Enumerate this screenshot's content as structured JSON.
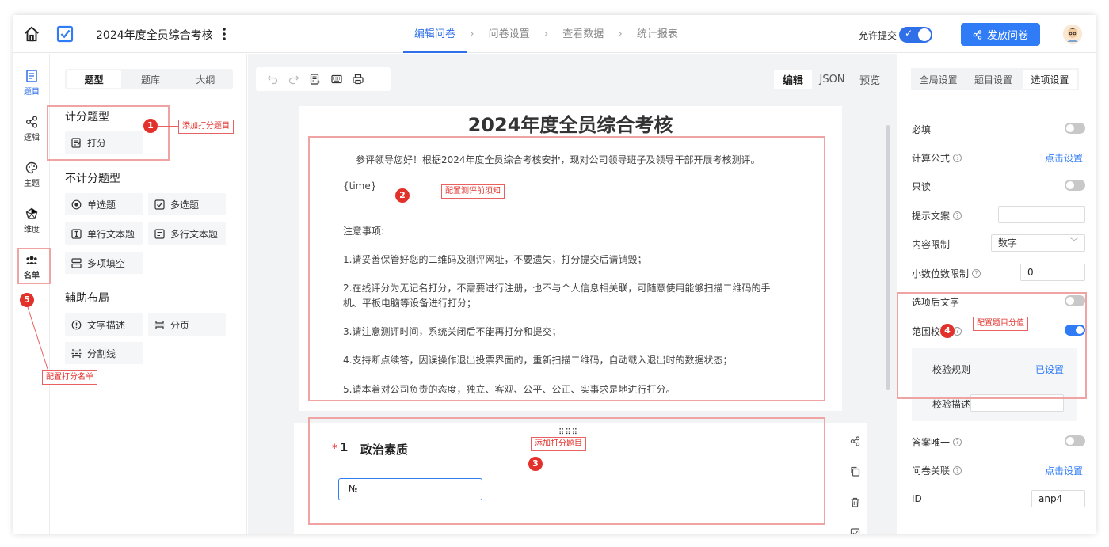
{
  "header": {
    "survey_title": "2024年度全员综合考核",
    "steps": [
      "编辑问卷",
      "问卷设置",
      "查看数据",
      "统计报表"
    ],
    "allow_submit_label": "允许提交",
    "publish_label": "发放问卷"
  },
  "rail": {
    "items": [
      "题目",
      "逻辑",
      "主题",
      "维度",
      "名单"
    ]
  },
  "panel": {
    "tabs": [
      "题型",
      "题库",
      "大纲"
    ],
    "sections": {
      "scoring": "计分题型",
      "non_scoring": "不计分题型",
      "layout": "辅助布局"
    },
    "scoring_widgets": [
      "打分"
    ],
    "non_scoring_widgets": [
      "单选题",
      "多选题",
      "单行文本题",
      "多行文本题",
      "多项填空"
    ],
    "layout_widgets": [
      "文字描述",
      "分页",
      "分割线"
    ]
  },
  "canvas": {
    "view_tabs": [
      "编辑",
      "JSON",
      "预览"
    ],
    "paper_title": "2024年度全员综合考核",
    "notice_lines": [
      "参评领导您好！根据2024年度全员综合考核安排，现对公司领导班子及领导干部开展考核测评。",
      "{time}",
      "注意事项:",
      "1.请妥善保管好您的二维码及测评网址，不要遗失，打分提交后请销毁；",
      "2.在线评分为无记名打分，不需要进行注册，也不与个人信息相关联，可随意使用能够扫描二维码的手",
      "机、平板电脑等设备进行打分；",
      "3.请注意测评时间，系统关闭后不能再打分和提交；",
      "4.支持断点续答，因误操作退出投票界面的，重新扫描二维码，自动载入退出时的数据状态；",
      "5.请本着对公司负责的态度，独立、客观、公平、公正、实事求是地进行打分。"
    ],
    "question": {
      "required_mark": "*",
      "number": "1",
      "title": "政治素质",
      "input_value": "№"
    }
  },
  "rpanel": {
    "tabs": [
      "全局设置",
      "题目设置",
      "选项设置"
    ],
    "rows": {
      "required": "必填",
      "formula": "计算公式",
      "formula_link": "点击设置",
      "readonly": "只读",
      "hint": "提示文案",
      "content_limit": "内容限制",
      "content_limit_value": "数字",
      "decimal_limit": "小数位数限制",
      "decimal_value": "0",
      "after_text": "选项后文字",
      "range_check": "范围校验",
      "check_rule": "校验规则",
      "check_rule_link": "已设置",
      "check_desc": "校验描述",
      "unique": "答案唯一",
      "link_survey": "问卷关联",
      "link_survey_link": "点击设置",
      "id_label": "ID",
      "id_value": "anp4"
    }
  },
  "annotations": {
    "a1": {
      "num": "1",
      "label": "添加打分题目"
    },
    "a2": {
      "num": "2",
      "label": "配置测评前须知"
    },
    "a3": {
      "num": "3",
      "label": "添加打分题目"
    },
    "a4": {
      "num": "4",
      "label": "配置题目分值"
    },
    "a5": {
      "num": "5",
      "label": "配置打分名单"
    }
  },
  "colors": {
    "accent": "#2f7cf6",
    "annotation": "#e2312b"
  }
}
